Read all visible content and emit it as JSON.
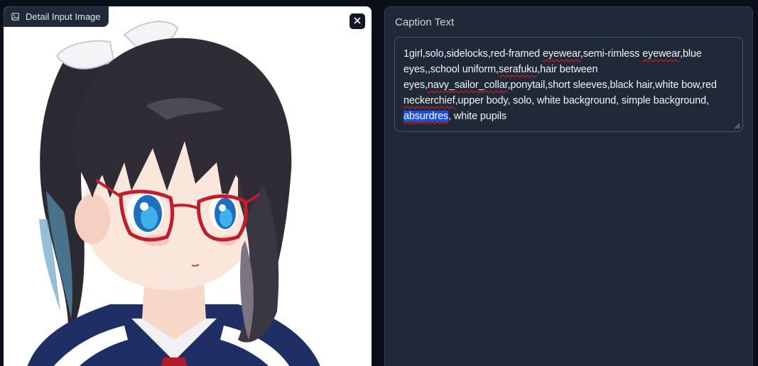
{
  "image_panel": {
    "label": "Detail Input Image",
    "label_icon": "image-icon",
    "close_icon": "close-icon"
  },
  "caption": {
    "title": "Caption Text",
    "parts": {
      "p1": "1girl,solo,sidelocks,red-framed ",
      "p2": "eyewear",
      "p3": ",semi-rimless ",
      "p4": "eyewear",
      "p5": ",",
      "p6": "blue eyes,,school uniform,",
      "p7": "serafuku",
      "p8": ",hair between eyes,",
      "p9": "navy_sailor_collar",
      "p10": ",ponytail,short sleeves,black hair,white bow,red ",
      "p11": "neckerchief",
      "p12": ",upper body, solo, white background, simple background, ",
      "p13": "absurdres",
      "p14": ", white pupils"
    }
  },
  "colors": {
    "background": "#0b0f19",
    "panel": "#1f2937",
    "selection": "#1d4ed8",
    "spellcheck": "#dc2626"
  }
}
